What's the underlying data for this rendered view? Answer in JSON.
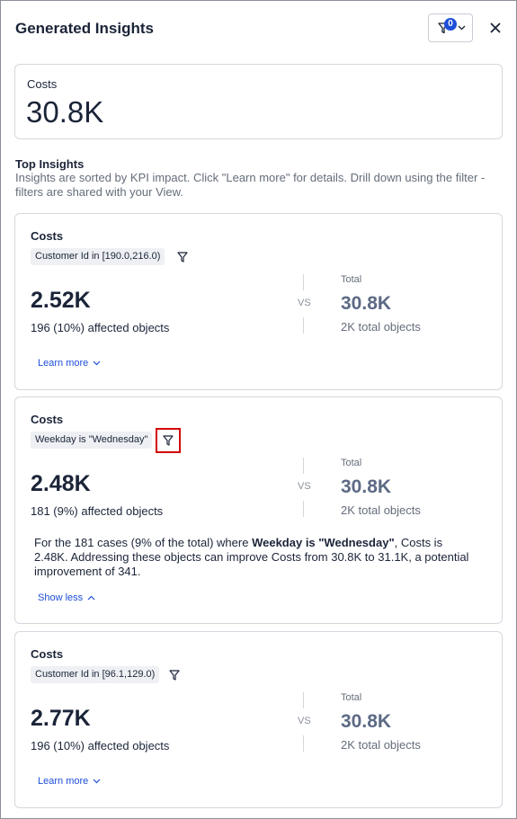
{
  "header": {
    "title": "Generated Insights",
    "filter_count": "0"
  },
  "kpi": {
    "label": "Costs",
    "value": "30.8K"
  },
  "top_insights": {
    "title": "Top Insights",
    "description": "Insights are sorted by KPI impact. Click \"Learn more\" for details. Drill down using the filter - filters are shared with your View."
  },
  "cards": [
    {
      "metric": "Costs",
      "condition": "Customer Id in [190.0,216.0)",
      "value": "2.52K",
      "affected": "196 (10%) affected objects",
      "vs": "VS",
      "total_label": "Total",
      "total_value": "30.8K",
      "total_objects": "2K total objects",
      "link": "Learn more"
    },
    {
      "metric": "Costs",
      "condition": "Weekday is \"Wednesday\"",
      "value": "2.48K",
      "affected": "181 (9%) affected objects",
      "vs": "VS",
      "total_label": "Total",
      "total_value": "30.8K",
      "total_objects": "2K total objects",
      "detail_pre": "For the 181 cases (9% of the total) where ",
      "detail_bold": "Weekday is \"Wednesday\"",
      "detail_post": ", Costs is 2.48K. Addressing these objects can improve Costs from 30.8K to 31.1K, a potential improvement of 341.",
      "link": "Show less"
    },
    {
      "metric": "Costs",
      "condition": "Customer Id in [96.1,129.0)",
      "value": "2.77K",
      "affected": "196 (10%) affected objects",
      "vs": "VS",
      "total_label": "Total",
      "total_value": "30.8K",
      "total_objects": "2K total objects",
      "link": "Learn more"
    }
  ],
  "colors": {
    "accent": "#1d4ed8",
    "highlight": "#d40000",
    "text": "#1b2438",
    "muted": "#656d7a"
  },
  "icons": [
    "filter-icon",
    "chevron-down-icon",
    "close-icon",
    "chevron-up-icon"
  ]
}
